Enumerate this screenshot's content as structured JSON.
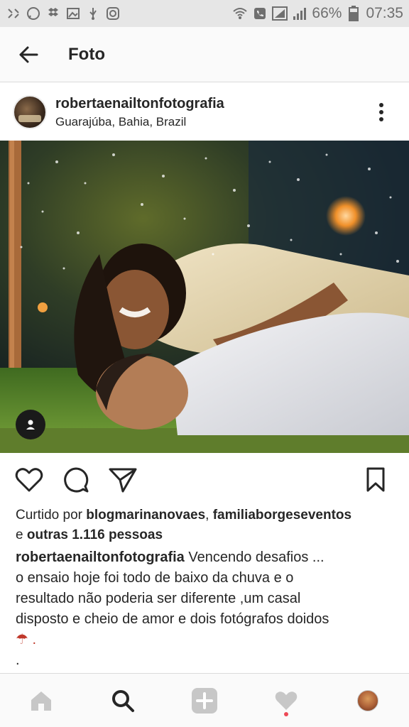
{
  "status_bar": {
    "battery": "66%",
    "time": "07:35"
  },
  "header": {
    "title": "Foto"
  },
  "post": {
    "username": "robertaenailtonfotografia",
    "location": "Guarajúba, Bahia, Brazil"
  },
  "likes": {
    "prefix": "Curtido por ",
    "user1": "blogmarinanovaes",
    "separator": ", ",
    "user2": "familiaborgeseventos",
    "conj": "e ",
    "others": "outras 1.116 pessoas"
  },
  "caption": {
    "username": "robertaenailtonfotografia",
    "line1": " Vencendo desafios ...",
    "line2": "o ensaio hoje foi todo de baixo da chuva e o",
    "line3": "resultado não poderia ser diferente ,um casal",
    "line4": "disposto e cheio de amor e dois fotógrafos doidos",
    "line5": "☂ .",
    "line6": "."
  },
  "icons": {
    "back": "arrow-left",
    "more": "vertical-dots",
    "like": "heart-outline",
    "comment": "speech-bubble",
    "share": "paper-plane",
    "save": "bookmark",
    "home": "home",
    "search": "magnifier",
    "add": "plus-square",
    "activity": "heart",
    "profile": "avatar"
  },
  "colors": {
    "status_bar_bg": "#e6e6e6",
    "text": "#262626",
    "notification_dot": "#ed4956"
  }
}
